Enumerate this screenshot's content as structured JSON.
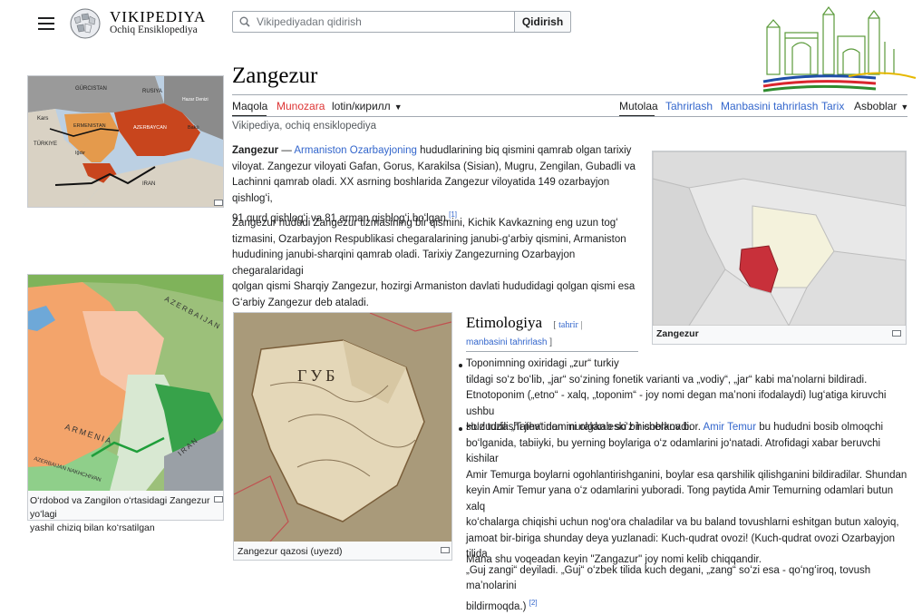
{
  "header": {
    "wordmark": "VIKIPEDIYA",
    "tagline": "Ochiq Ensiklopediya",
    "search_placeholder": "Vikipediyadan qidirish",
    "search_button": "Qidirish"
  },
  "article": {
    "title": "Zangezur",
    "tabs_left": [
      "Maqola",
      "Munozara"
    ],
    "script_switch": "lotin/кирилл",
    "tabs_right": [
      "Mutolaa",
      "Tahrirlash",
      "Manbasini tahrirlash",
      "Tarix",
      "Asboblar"
    ],
    "from": "Vikipediya, ochiq ensiklopediya",
    "lead_bold": "Zangezur",
    "lead_dash": " — ",
    "lead_link": "Armaniston Ozarbayjoning",
    "lead_lines": [
      "hududlarining biq qismini qamrab olgan tarixiy",
      "viloyat. Zangezur viloyati Gafan, Gorus, Karakilsa (Sisian), Mugru, Zengilan, Gubadli va",
      "Lachinni qamrab oladi. XX asrning boshlarida Zangezur viloyatida 149 ozarbayjon qishlogʻi,",
      "91 qurd qishlogʻi va 81 arman qishlogʻi boʻlgan."
    ],
    "lead_ref": "[1]",
    "para2_lines": [
      "Zangezur hududi Zangezur tizmasining bir qismini, Kichik Kavkazning eng uzun togʻ",
      "tizmasini, Ozarbayjon Respublikasi chegaralarining janubi-gʻarbiy qismini, Armaniston",
      "hududining janubi-sharqini qamrab oladi. Tarixiy Zangezurning Ozarbayjon chegaralaridagi",
      "qolgan qismi Sharqiy Zangezur, hozirgi Armaniston davlati hududidagi qolgan qismi esa",
      "Gʻarbiy Zangezur deb ataladi."
    ]
  },
  "etymology": {
    "heading": "Etimologiya",
    "edit_link": "tahrir",
    "source_edit_link": "manbasini tahrirlash",
    "bullet1_lines": [
      "Toponimning oxiridagi „zur“ turkiy",
      "tildagi soʻz boʻlib, „jar“ soʻzining fonetik varianti va „vodiy“, „jar“ kabi maʼnolarni bildiradi.",
      "Etnotoponim („etno“ - xalq, „toponim“ - joy nomi degan maʼnoni ifodalaydi) lugʻatiga kiruvchi ushbu",
      "soʻz tuzilishi jihatidan murakkab soʻz hisoblanadi."
    ],
    "bullet2_pre": "Hududda „Tatev“ nomini olgan eski bir cherkov bor.",
    "bullet2_link": "Amir Temur",
    "bullet2_first_tail": "bu hududni bosib olmoqchi",
    "bullet2_lines": [
      "boʻlganida, tabiiyki, bu yerning boylariga oʻz odamlarini joʻnatadi. Atrofidagi xabar beruvchi kishilar",
      "Amir Temurga boylarni ogohlantirishganini, boylar esa qarshilik qilishganini bildiradilar. Shundan",
      "keyin Amir Temur yana oʻz odamlarini yuboradi. Tong paytida Amir Temurning odamlari butun xalq",
      "koʻchalarga chiqishi uchun nogʻora chaladilar va bu baland tovushlarni eshitgan butun xaloyiq,",
      "jamoat bir-biriga shunday deya yuzlanadi: Kuch-qudrat ovozi! (Kuch-qudrat ovozi Ozarbayjon tilida",
      "„Guj zangi“ deyiladi. „Guj“ oʻzbek tilida kuch degani, „zang“ soʻzi esa - qoʻngʻiroq, tovush maʼnolarini",
      "bildirmoqda.)"
    ],
    "bullet2_ref": "[2]",
    "closing": "Mana shu voqeadan keyin \"Zangazur\" joy nomi kelib chiqqandir."
  },
  "figures": {
    "map1_labels": [
      "GÜRCISTAN",
      "RUSIYA",
      "Hazar Denizi",
      "Kars",
      "TÜRKIYE",
      "ERMENISTAN",
      "AZERBAYCAN",
      "Bakü",
      "Iğdır",
      "IRAN"
    ],
    "map2_labels": [
      "AZERBAIJAN",
      "ARMENIA",
      "AZERBAIJAN NAKHCHIVAN",
      "IRAN"
    ],
    "map2_caption": [
      "Oʻrdobod va Zangilon oʻrtasidagi Zangezur yoʻlagi",
      "yashil chiziq bilan koʻrsatilgan"
    ],
    "map3_caption": "Zangezur qazosi (uyezd)",
    "map4_caption": "Zangezur",
    "map3_label": "ГУБ"
  },
  "colors": {
    "link": "#3366cc",
    "red_link": "#dd3333",
    "highlight_region": "#c8303a"
  }
}
